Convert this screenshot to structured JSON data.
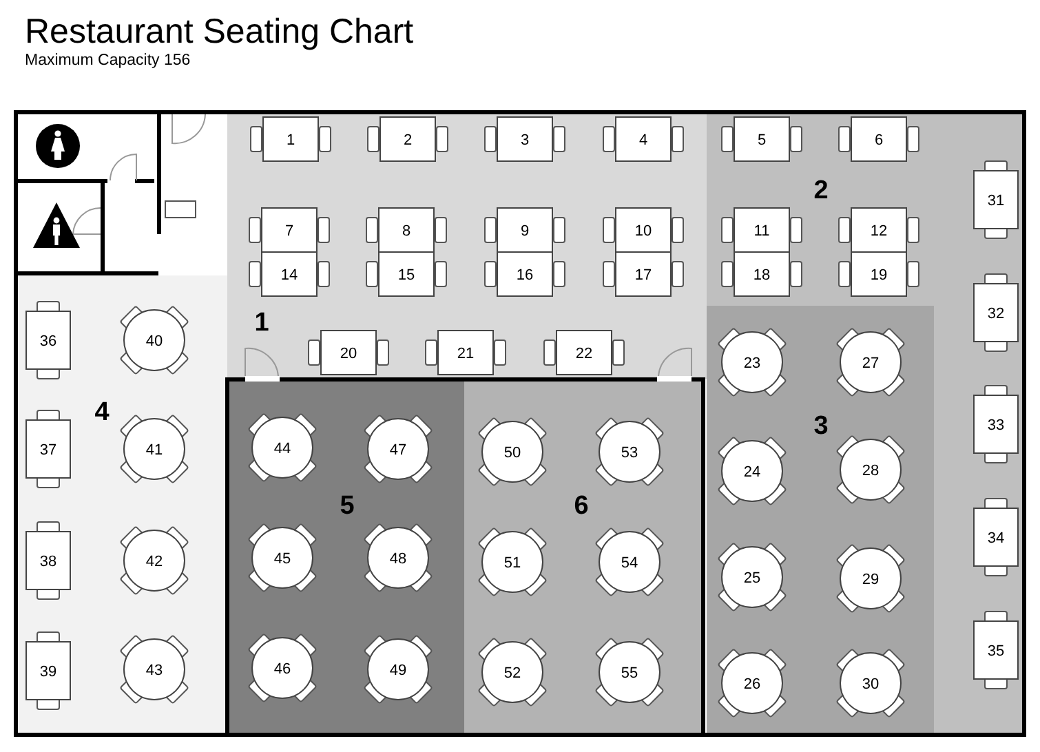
{
  "title": "Restaurant Seating Chart",
  "subtitle": "Maximum Capacity 156",
  "zones": [
    {
      "label": "1",
      "color": "#d9d9d9",
      "tables": [
        {
          "number": "1",
          "kind": "wide"
        },
        {
          "number": "2",
          "kind": "wide"
        },
        {
          "number": "3",
          "kind": "wide"
        },
        {
          "number": "4",
          "kind": "wide"
        },
        {
          "number": "7",
          "kind": "wide"
        },
        {
          "number": "8",
          "kind": "wide"
        },
        {
          "number": "9",
          "kind": "wide"
        },
        {
          "number": "10",
          "kind": "wide"
        },
        {
          "number": "14",
          "kind": "wide"
        },
        {
          "number": "15",
          "kind": "wide"
        },
        {
          "number": "16",
          "kind": "wide"
        },
        {
          "number": "17",
          "kind": "wide"
        },
        {
          "number": "20",
          "kind": "wide"
        },
        {
          "number": "21",
          "kind": "wide"
        },
        {
          "number": "22",
          "kind": "wide"
        }
      ]
    },
    {
      "label": "2",
      "color": "#bfbfbf",
      "tables": [
        {
          "number": "5",
          "kind": "wide"
        },
        {
          "number": "6",
          "kind": "wide"
        },
        {
          "number": "11",
          "kind": "wide"
        },
        {
          "number": "12",
          "kind": "wide"
        },
        {
          "number": "18",
          "kind": "wide"
        },
        {
          "number": "19",
          "kind": "wide"
        },
        {
          "number": "31",
          "kind": "tall"
        },
        {
          "number": "32",
          "kind": "tall"
        },
        {
          "number": "33",
          "kind": "tall"
        },
        {
          "number": "34",
          "kind": "tall"
        },
        {
          "number": "35",
          "kind": "tall"
        }
      ]
    },
    {
      "label": "3",
      "color": "#a6a6a6",
      "tables": [
        {
          "number": "23",
          "kind": "round"
        },
        {
          "number": "24",
          "kind": "round"
        },
        {
          "number": "25",
          "kind": "round"
        },
        {
          "number": "26",
          "kind": "round"
        },
        {
          "number": "27",
          "kind": "round"
        },
        {
          "number": "28",
          "kind": "round"
        },
        {
          "number": "29",
          "kind": "round"
        },
        {
          "number": "30",
          "kind": "round"
        }
      ]
    },
    {
      "label": "4",
      "color": "#f2f2f2",
      "tables": [
        {
          "number": "36",
          "kind": "tall"
        },
        {
          "number": "37",
          "kind": "tall"
        },
        {
          "number": "38",
          "kind": "tall"
        },
        {
          "number": "39",
          "kind": "tall"
        },
        {
          "number": "40",
          "kind": "round"
        },
        {
          "number": "41",
          "kind": "round"
        },
        {
          "number": "42",
          "kind": "round"
        },
        {
          "number": "43",
          "kind": "round"
        }
      ]
    },
    {
      "label": "5",
      "color": "#808080",
      "tables": [
        {
          "number": "44",
          "kind": "round"
        },
        {
          "number": "45",
          "kind": "round"
        },
        {
          "number": "46",
          "kind": "round"
        },
        {
          "number": "47",
          "kind": "round"
        },
        {
          "number": "48",
          "kind": "round"
        },
        {
          "number": "49",
          "kind": "round"
        }
      ]
    },
    {
      "label": "6",
      "color": "#b3b3b3",
      "tables": [
        {
          "number": "50",
          "kind": "round"
        },
        {
          "number": "51",
          "kind": "round"
        },
        {
          "number": "52",
          "kind": "round"
        },
        {
          "number": "53",
          "kind": "round"
        },
        {
          "number": "54",
          "kind": "round"
        },
        {
          "number": "55",
          "kind": "round"
        }
      ]
    }
  ]
}
